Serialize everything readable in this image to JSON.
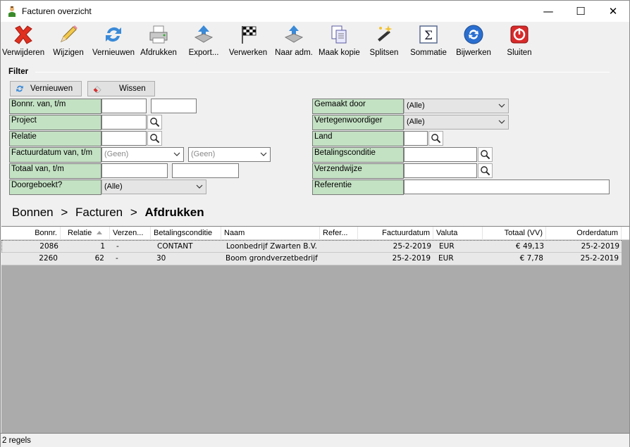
{
  "window": {
    "title": "Facturen overzicht",
    "minimize": "—",
    "maximize": "☐",
    "close": "✕"
  },
  "toolbar": [
    {
      "label": "Verwijderen",
      "icon": "delete-x-icon"
    },
    {
      "label": "Wijzigen",
      "icon": "pencil-icon"
    },
    {
      "label": "Vernieuwen",
      "icon": "refresh-icon"
    },
    {
      "label": "Afdrukken",
      "icon": "printer-icon"
    },
    {
      "label": "Export...",
      "icon": "export-icon"
    },
    {
      "label": "Verwerken",
      "icon": "checkered-flag-icon"
    },
    {
      "label": "Naar adm.",
      "icon": "to-admin-icon"
    },
    {
      "label": "Maak kopie",
      "icon": "copy-icon"
    },
    {
      "label": "Splitsen",
      "icon": "magic-wand-icon"
    },
    {
      "label": "Sommatie",
      "icon": "sigma-icon"
    },
    {
      "label": "Bijwerken",
      "icon": "update-icon"
    },
    {
      "label": "Sluiten",
      "icon": "power-icon"
    }
  ],
  "filter": {
    "title": "Filter",
    "refresh_btn": "Vernieuwen",
    "clear_btn": "Wissen",
    "bonnr_label": "Bonnr. van, t/m",
    "project_label": "Project",
    "relatie_label": "Relatie",
    "factuurdatum_label": "Factuurdatum van, t/m",
    "factuurdatum_from": "(Geen)",
    "factuurdatum_to": "(Geen)",
    "totaal_label": "Totaal van, t/m",
    "doorgeboekt_label": "Doorgeboekt?",
    "doorgeboekt_value": "(Alle)",
    "gemaakt_label": "Gemaakt door",
    "gemaakt_value": "(Alle)",
    "vertegenwoordiger_label": "Vertegenwoordiger",
    "vertegenwoordiger_value": "(Alle)",
    "land_label": "Land",
    "betalingsconditie_label": "Betalingsconditie",
    "verzendwijze_label": "Verzendwijze",
    "referentie_label": "Referentie"
  },
  "breadcrumb": {
    "items": [
      "Bonnen",
      ">",
      "Facturen",
      ">"
    ],
    "current": "Afdrukken"
  },
  "table": {
    "columns": [
      "Bonnr.",
      "Relatie",
      "Verzen...",
      "Betalingsconditie",
      "Naam",
      "Refer...",
      "Factuurdatum",
      "Valuta",
      "Totaal (VV)",
      "Orderdatum"
    ],
    "rows": [
      [
        "2086",
        "1",
        "-",
        "CONTANT",
        "Loonbedrijf Zwarten B.V.",
        "",
        "25-2-2019",
        "EUR",
        "€ 49,13",
        "25-2-2019"
      ],
      [
        "2260",
        "62",
        "-",
        "30",
        "Boom grondverzetbedrijf",
        "",
        "25-2-2019",
        "EUR",
        "€ 7,78",
        "25-2-2019"
      ]
    ]
  },
  "status": {
    "text": "2 regels"
  }
}
